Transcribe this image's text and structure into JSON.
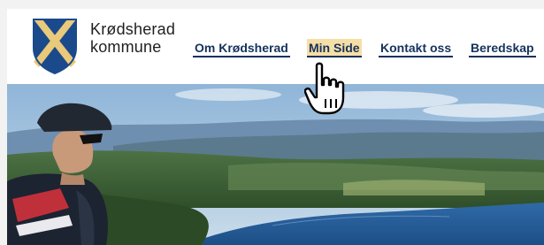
{
  "brand": {
    "line1": "Krødsherad",
    "line2": "kommune",
    "logo_colors": {
      "blue": "#1b4a8c",
      "gold": "#e9c97a"
    }
  },
  "nav": {
    "items": [
      {
        "label": "Om Krødsherad",
        "active": false
      },
      {
        "label": "Min Side",
        "active": true
      },
      {
        "label": "Kontakt oss",
        "active": false
      },
      {
        "label": "Beredskap",
        "active": false
      }
    ],
    "link_color": "#16325c",
    "highlight_color": "#f6dfa6"
  },
  "hero": {
    "description_icon": "landscape-photo-cyclist"
  },
  "pointer": {
    "icon": "hand-pointer-icon"
  }
}
